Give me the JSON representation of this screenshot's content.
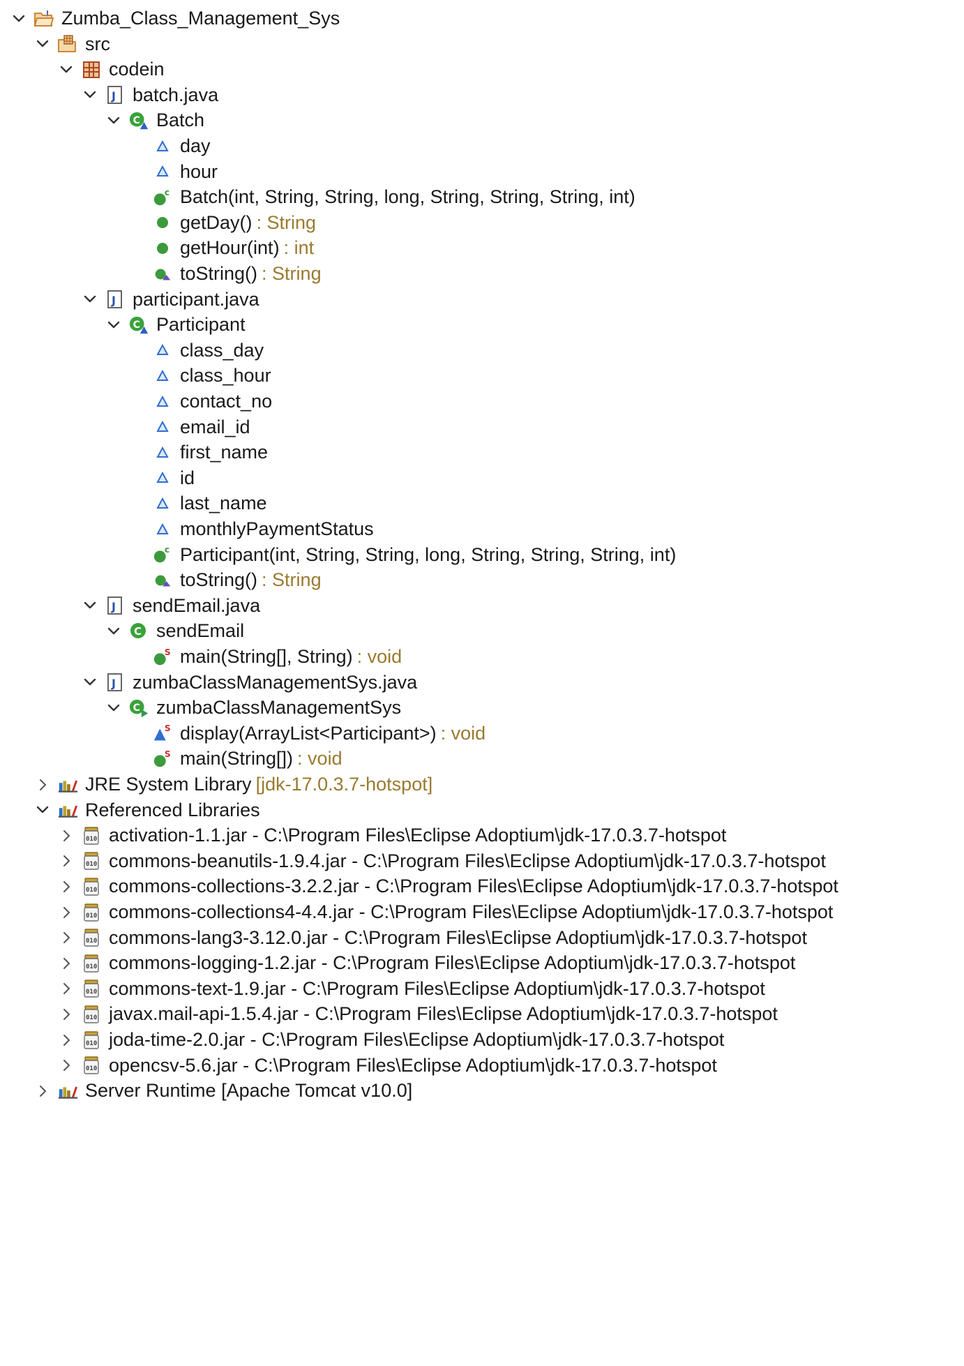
{
  "tree": [
    {
      "depth": 0,
      "expanded": true,
      "icon": "project-folder-icon",
      "label": "Zumba_Class_Management_Sys",
      "decoration": ""
    },
    {
      "depth": 1,
      "expanded": true,
      "icon": "source-folder-icon",
      "label": "src",
      "decoration": ""
    },
    {
      "depth": 2,
      "expanded": true,
      "icon": "package-icon",
      "label": "codein",
      "decoration": ""
    },
    {
      "depth": 3,
      "expanded": true,
      "icon": "java-file-icon",
      "label": "batch.java",
      "decoration": ""
    },
    {
      "depth": 4,
      "expanded": true,
      "icon": "class-icon",
      "label": "Batch",
      "decoration": ""
    },
    {
      "depth": 5,
      "expanded": null,
      "icon": "field-default-icon",
      "label": "day",
      "decoration": ""
    },
    {
      "depth": 5,
      "expanded": null,
      "icon": "field-default-icon",
      "label": "hour",
      "decoration": ""
    },
    {
      "depth": 5,
      "expanded": null,
      "icon": "constructor-icon",
      "label": "Batch(int, String, String, long, String, String, String, int)",
      "decoration": ""
    },
    {
      "depth": 5,
      "expanded": null,
      "icon": "method-public-icon",
      "label": "getDay()",
      "decoration": ": String"
    },
    {
      "depth": 5,
      "expanded": null,
      "icon": "method-public-icon",
      "label": "getHour(int)",
      "decoration": ": int"
    },
    {
      "depth": 5,
      "expanded": null,
      "icon": "method-override-icon",
      "label": "toString()",
      "decoration": ": String"
    },
    {
      "depth": 3,
      "expanded": true,
      "icon": "java-file-icon",
      "label": "participant.java",
      "decoration": ""
    },
    {
      "depth": 4,
      "expanded": true,
      "icon": "class-icon",
      "label": "Participant",
      "decoration": ""
    },
    {
      "depth": 5,
      "expanded": null,
      "icon": "field-default-icon",
      "label": "class_day",
      "decoration": ""
    },
    {
      "depth": 5,
      "expanded": null,
      "icon": "field-default-icon",
      "label": "class_hour",
      "decoration": ""
    },
    {
      "depth": 5,
      "expanded": null,
      "icon": "field-default-icon",
      "label": "contact_no",
      "decoration": ""
    },
    {
      "depth": 5,
      "expanded": null,
      "icon": "field-default-icon",
      "label": "email_id",
      "decoration": ""
    },
    {
      "depth": 5,
      "expanded": null,
      "icon": "field-default-icon",
      "label": "first_name",
      "decoration": ""
    },
    {
      "depth": 5,
      "expanded": null,
      "icon": "field-default-icon",
      "label": "id",
      "decoration": ""
    },
    {
      "depth": 5,
      "expanded": null,
      "icon": "field-default-icon",
      "label": "last_name",
      "decoration": ""
    },
    {
      "depth": 5,
      "expanded": null,
      "icon": "field-default-icon",
      "label": "monthlyPaymentStatus",
      "decoration": ""
    },
    {
      "depth": 5,
      "expanded": null,
      "icon": "constructor-icon",
      "label": "Participant(int, String, String, long, String, String, String, int)",
      "decoration": ""
    },
    {
      "depth": 5,
      "expanded": null,
      "icon": "method-override-icon",
      "label": "toString()",
      "decoration": ": String"
    },
    {
      "depth": 3,
      "expanded": true,
      "icon": "java-file-icon",
      "label": "sendEmail.java",
      "decoration": ""
    },
    {
      "depth": 4,
      "expanded": true,
      "icon": "class-plain-icon",
      "label": "sendEmail",
      "decoration": ""
    },
    {
      "depth": 5,
      "expanded": null,
      "icon": "static-method-icon",
      "label": "main(String[], String)",
      "decoration": ": void"
    },
    {
      "depth": 3,
      "expanded": true,
      "icon": "java-file-icon",
      "label": "zumbaClassManagementSys.java",
      "decoration": ""
    },
    {
      "depth": 4,
      "expanded": true,
      "icon": "class-main-icon",
      "label": "zumbaClassManagementSys",
      "decoration": ""
    },
    {
      "depth": 5,
      "expanded": null,
      "icon": "static-default-method-icon",
      "label": "display(ArrayList<Participant>)",
      "decoration": ": void"
    },
    {
      "depth": 5,
      "expanded": null,
      "icon": "static-method-icon",
      "label": "main(String[])",
      "decoration": ": void"
    },
    {
      "depth": 1,
      "expanded": false,
      "icon": "library-icon",
      "label": "JRE System Library",
      "decoration": "[jdk-17.0.3.7-hotspot]"
    },
    {
      "depth": 1,
      "expanded": true,
      "icon": "library-icon",
      "label": "Referenced Libraries",
      "decoration": ""
    },
    {
      "depth": 2,
      "expanded": false,
      "icon": "jar-icon",
      "label": "activation-1.1.jar - C:\\Program Files\\Eclipse Adoptium\\jdk-17.0.3.7-hotspot",
      "decoration": ""
    },
    {
      "depth": 2,
      "expanded": false,
      "icon": "jar-icon",
      "label": "commons-beanutils-1.9.4.jar - C:\\Program Files\\Eclipse Adoptium\\jdk-17.0.3.7-hotspot",
      "decoration": ""
    },
    {
      "depth": 2,
      "expanded": false,
      "icon": "jar-icon",
      "label": "commons-collections-3.2.2.jar - C:\\Program Files\\Eclipse Adoptium\\jdk-17.0.3.7-hotspot",
      "decoration": ""
    },
    {
      "depth": 2,
      "expanded": false,
      "icon": "jar-icon",
      "label": "commons-collections4-4.4.jar - C:\\Program Files\\Eclipse Adoptium\\jdk-17.0.3.7-hotspot",
      "decoration": ""
    },
    {
      "depth": 2,
      "expanded": false,
      "icon": "jar-icon",
      "label": "commons-lang3-3.12.0.jar - C:\\Program Files\\Eclipse Adoptium\\jdk-17.0.3.7-hotspot",
      "decoration": ""
    },
    {
      "depth": 2,
      "expanded": false,
      "icon": "jar-icon",
      "label": "commons-logging-1.2.jar - C:\\Program Files\\Eclipse Adoptium\\jdk-17.0.3.7-hotspot",
      "decoration": ""
    },
    {
      "depth": 2,
      "expanded": false,
      "icon": "jar-icon",
      "label": "commons-text-1.9.jar - C:\\Program Files\\Eclipse Adoptium\\jdk-17.0.3.7-hotspot",
      "decoration": ""
    },
    {
      "depth": 2,
      "expanded": false,
      "icon": "jar-icon",
      "label": "javax.mail-api-1.5.4.jar - C:\\Program Files\\Eclipse Adoptium\\jdk-17.0.3.7-hotspot",
      "decoration": ""
    },
    {
      "depth": 2,
      "expanded": false,
      "icon": "jar-icon",
      "label": "joda-time-2.0.jar - C:\\Program Files\\Eclipse Adoptium\\jdk-17.0.3.7-hotspot",
      "decoration": ""
    },
    {
      "depth": 2,
      "expanded": false,
      "icon": "jar-icon",
      "label": "opencsv-5.6.jar - C:\\Program Files\\Eclipse Adoptium\\jdk-17.0.3.7-hotspot",
      "decoration": ""
    },
    {
      "depth": 1,
      "expanded": false,
      "icon": "library-icon",
      "label": "Server Runtime [Apache Tomcat v10.0]",
      "decoration": ""
    }
  ],
  "colors": {
    "text": "#1a1a1a",
    "decoration": "#9a7a2f",
    "method-green": "#3c9a3c",
    "class-green": "#35a435",
    "field-blue": "#2f6fd0",
    "folder-orange": "#e08a2b",
    "package-brown": "#b3542f",
    "library-olive": "#8a7a24",
    "jar-gray": "#8a8a8a"
  }
}
